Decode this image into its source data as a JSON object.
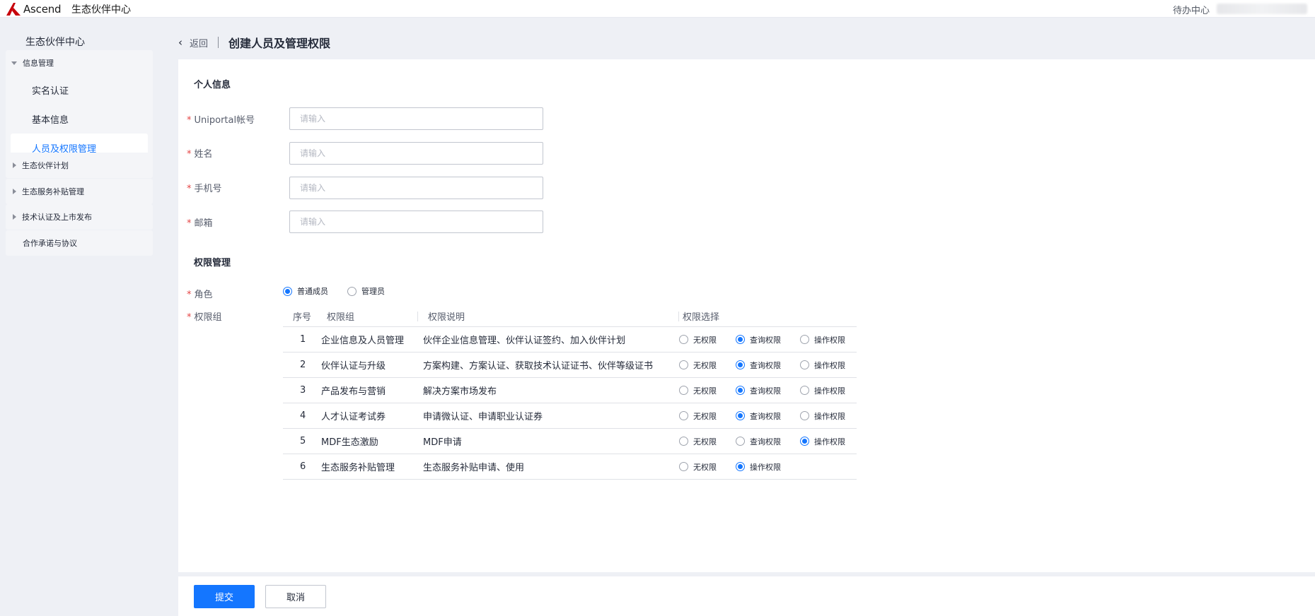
{
  "topbar": {
    "logo_text": "Ascend",
    "app_title": "生态伙伴中心",
    "todo_label": "待办中心"
  },
  "colors": {
    "accent": "#1476ff",
    "required": "#e54545",
    "logo": "#c7000b"
  },
  "sidebar": {
    "title": "生态伙伴中心",
    "groups": [
      {
        "label": "信息管理",
        "expanded": true,
        "items": [
          {
            "label": "实名认证",
            "active": false
          },
          {
            "label": "基本信息",
            "active": false
          },
          {
            "label": "人员及权限管理",
            "active": true
          }
        ]
      },
      {
        "label": "生态伙伴计划",
        "expanded": false
      },
      {
        "label": "生态服务补贴管理",
        "expanded": false
      },
      {
        "label": "技术认证及上市发布",
        "expanded": false
      },
      {
        "label": "合作承诺与协议",
        "expanded": false
      }
    ]
  },
  "header": {
    "back_label": "返回",
    "page_title": "创建人员及管理权限"
  },
  "personal": {
    "section_title": "个人信息",
    "fields": [
      {
        "label": "Uniportal帐号",
        "required": true,
        "value": "",
        "placeholder": "请输入"
      },
      {
        "label": "姓名",
        "required": true,
        "value": "",
        "placeholder": "请输入"
      },
      {
        "label": "手机号",
        "required": true,
        "value": "",
        "placeholder": "请输入"
      },
      {
        "label": "邮箱",
        "required": true,
        "value": "",
        "placeholder": "请输入"
      }
    ]
  },
  "permission": {
    "section_title": "权限管理",
    "role_label": "角色",
    "role_options": [
      "普通成员",
      "管理员"
    ],
    "role_selected": "普通成员",
    "group_label": "权限组",
    "columns": [
      "序号",
      "权限组",
      "权限说明",
      "权限选择"
    ],
    "rows": [
      {
        "no": "1",
        "group": "企业信息及人员管理",
        "desc": "伙伴企业信息管理、伙伴认证签约、加入伙伴计划",
        "options": [
          "无权限",
          "查询权限",
          "操作权限"
        ],
        "selected": "查询权限"
      },
      {
        "no": "2",
        "group": "伙伴认证与升级",
        "desc": "方案构建、方案认证、获取技术认证证书、伙伴等级证书",
        "options": [
          "无权限",
          "查询权限",
          "操作权限"
        ],
        "selected": "查询权限"
      },
      {
        "no": "3",
        "group": "产品发布与营销",
        "desc": "解决方案市场发布",
        "options": [
          "无权限",
          "查询权限",
          "操作权限"
        ],
        "selected": "查询权限"
      },
      {
        "no": "4",
        "group": "人才认证考试券",
        "desc": "申请微认证、申请职业认证券",
        "options": [
          "无权限",
          "查询权限",
          "操作权限"
        ],
        "selected": "查询权限"
      },
      {
        "no": "5",
        "group": "MDF生态激励",
        "desc": "MDF申请",
        "options": [
          "无权限",
          "查询权限",
          "操作权限"
        ],
        "selected": "操作权限"
      },
      {
        "no": "6",
        "group": "生态服务补贴管理",
        "desc": "生态服务补贴申请、使用",
        "options": [
          "无权限",
          "操作权限"
        ],
        "selected": "操作权限"
      }
    ]
  },
  "footer": {
    "submit_label": "提交",
    "cancel_label": "取消"
  }
}
